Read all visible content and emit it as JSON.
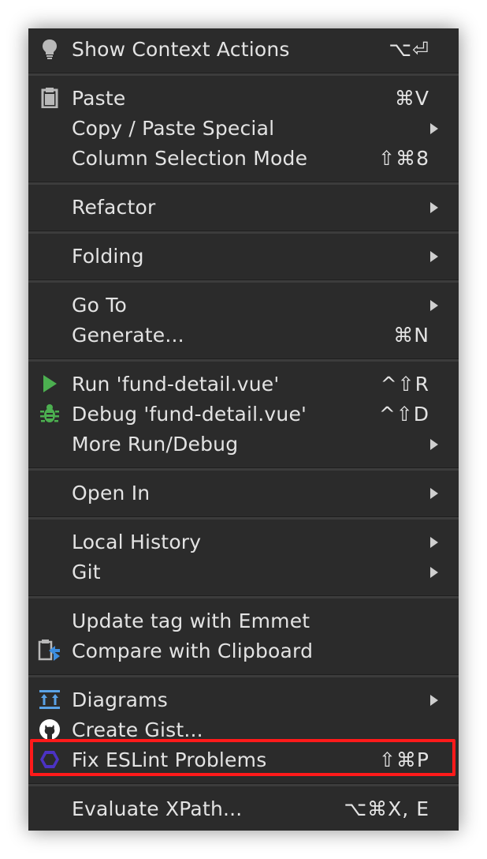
{
  "menu": {
    "items": [
      {
        "label": "Show Context Actions",
        "shortcut": "⌥⏎",
        "icon": "bulb-icon"
      },
      {
        "label": "Paste",
        "shortcut": "⌘V",
        "icon": "clipboard-icon"
      },
      {
        "label": "Copy / Paste Special",
        "submenu": true
      },
      {
        "label": "Column Selection Mode",
        "shortcut": "⇧⌘8"
      },
      {
        "label": "Refactor",
        "submenu": true
      },
      {
        "label": "Folding",
        "submenu": true
      },
      {
        "label": "Go To",
        "submenu": true
      },
      {
        "label": "Generate...",
        "shortcut": "⌘N"
      },
      {
        "label": "Run 'fund-detail.vue'",
        "shortcut": "^⇧R",
        "icon": "run-icon"
      },
      {
        "label": "Debug 'fund-detail.vue'",
        "shortcut": "^⇧D",
        "icon": "bug-icon"
      },
      {
        "label": "More Run/Debug",
        "submenu": true
      },
      {
        "label": "Open In",
        "submenu": true
      },
      {
        "label": "Local History",
        "submenu": true
      },
      {
        "label": "Git",
        "submenu": true
      },
      {
        "label": "Update tag with Emmet"
      },
      {
        "label": "Compare with Clipboard",
        "icon": "compare-clipboard-icon"
      },
      {
        "label": "Diagrams",
        "submenu": true,
        "icon": "diagram-icon"
      },
      {
        "label": "Create Gist...",
        "icon": "github-icon"
      },
      {
        "label": "Fix ESLint Problems",
        "shortcut": "⇧⌘P",
        "icon": "eslint-icon",
        "highlighted": true
      },
      {
        "label": "Evaluate XPath...",
        "shortcut": "⌥⌘X, E"
      }
    ]
  },
  "colors": {
    "menu_background": "#2b2b2b",
    "text": "#e3e3e3",
    "highlight_border": "#ff1a1a",
    "run_green": "#4caf50",
    "eslint_purple": "#4b32c3"
  }
}
